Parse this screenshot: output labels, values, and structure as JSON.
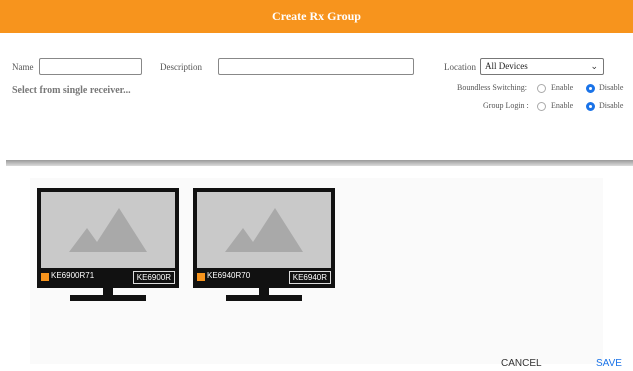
{
  "header": {
    "title": "Create Rx Group"
  },
  "form": {
    "name_label": "Name",
    "name_value": "",
    "description_label": "Description",
    "description_value": "",
    "location_label": "Location",
    "location_value": "All Devices",
    "hint": "Select from single receiver...",
    "boundless_label": "Boundless Switching:",
    "group_login_label": "Group Login :",
    "enable_label": "Enable",
    "disable_label": "Disable",
    "boundless_selected": "Disable",
    "group_login_selected": "Disable"
  },
  "receivers": [
    {
      "name": "KE6900R71",
      "model": "KE6900R"
    },
    {
      "name": "KE6940R70",
      "model": "KE6940R"
    }
  ],
  "colors": {
    "accent": "#f7941d",
    "link": "#1a73e8"
  },
  "actions": {
    "cancel": "CANCEL",
    "save": "SAVE"
  }
}
